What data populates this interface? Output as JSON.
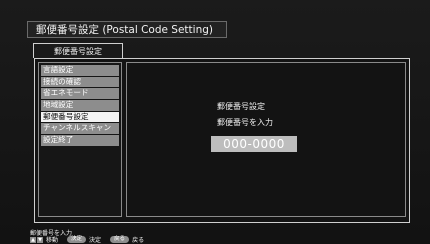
{
  "window": {
    "title": "郵便番号設定 (Postal Code Setting)"
  },
  "tab": {
    "label": "郵便番号設定"
  },
  "menu": {
    "items": [
      {
        "label": "言語設定",
        "selected": false
      },
      {
        "label": "接続の確認",
        "selected": false
      },
      {
        "label": "省エネモード",
        "selected": false
      },
      {
        "label": "地域設定",
        "selected": false
      },
      {
        "label": "郵便番号設定",
        "selected": true
      },
      {
        "label": "チャンネルスキャン",
        "selected": false
      },
      {
        "label": "設定終了",
        "selected": false
      }
    ]
  },
  "content": {
    "heading": "郵便番号設定",
    "instruction": "郵便番号を入力",
    "code_value": "000-0000"
  },
  "footer": {
    "hint": "郵便番号を入力",
    "up_glyph": "▲",
    "down_glyph": "▼",
    "move_label": "移動",
    "decide_key": "決定",
    "decide_label": "決定",
    "back_key": "戻る",
    "back_label": "戻る"
  },
  "colors": {
    "background": "#161616",
    "menu_item": "#8d8d8d",
    "menu_selected": "#f4f4f4",
    "code_box": "#bdbdbd"
  }
}
